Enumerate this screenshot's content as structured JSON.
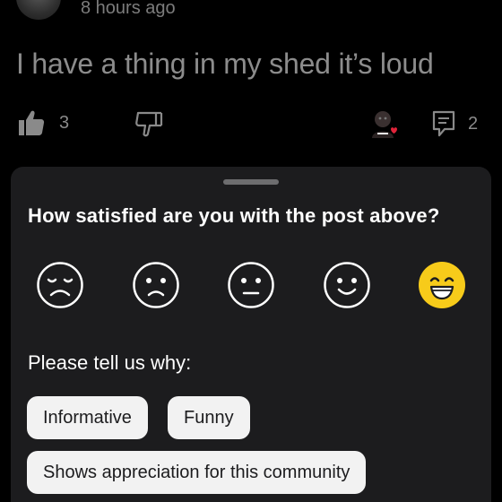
{
  "post": {
    "timestamp": "8 hours ago",
    "text": "I have a thing in my shed it’s loud"
  },
  "actions": {
    "upvote_count": "3",
    "comment_count": "2",
    "icons": [
      "thumbs-up-icon",
      "thumbs-down-icon",
      "user-award-avatar",
      "comment-icon"
    ]
  },
  "survey": {
    "question": "How satisfied are you with the post above?",
    "ratings": [
      "very-dissatisfied",
      "dissatisfied",
      "neutral",
      "satisfied",
      "very-satisfied"
    ],
    "selected_rating": "very-satisfied",
    "selected_color": "#F7CB1A",
    "reason_prompt": "Please tell us why:",
    "reasons": [
      "Informative",
      "Funny",
      "Shows appreciation for this community"
    ]
  }
}
